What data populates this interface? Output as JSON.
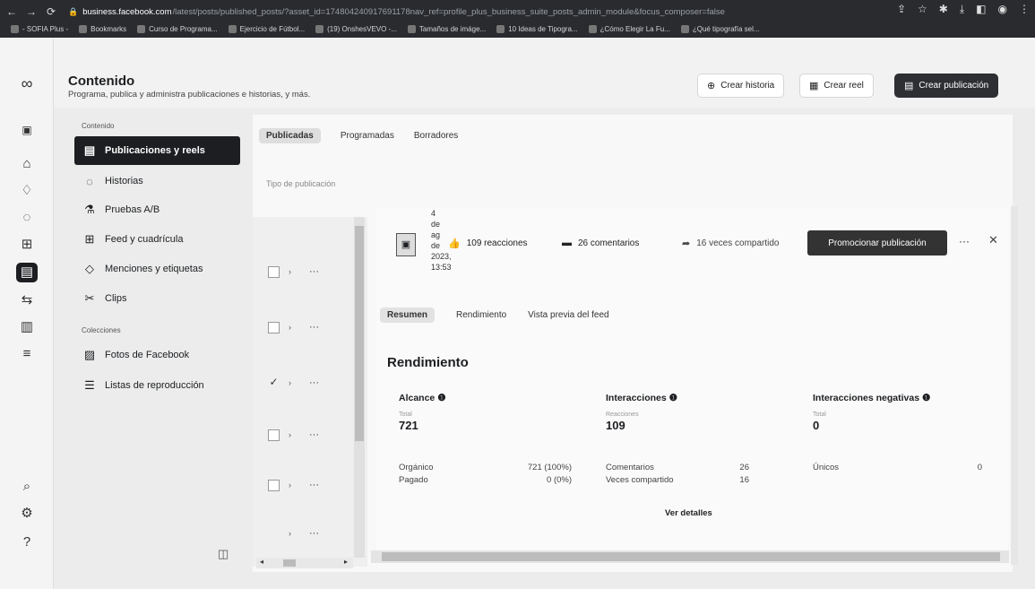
{
  "browser": {
    "url_host": "business.facebook.com",
    "url_path": "/latest/posts/published_posts/?asset_id=174804240917691178nav_ref=profile_plus_business_suite_posts_admin_module&focus_composer=false",
    "bookmarks": [
      {
        "label": "- SOFIA Plus -",
        "icon": "sena-icon"
      },
      {
        "label": "Bookmarks",
        "icon": "star-icon"
      },
      {
        "label": "Curso de Programa...",
        "icon": "globe-icon"
      },
      {
        "label": "Ejercicio de Fútbol...",
        "icon": "page-icon"
      },
      {
        "label": "(19) OnshesVEVO -...",
        "icon": "youtube-icon"
      },
      {
        "label": "Tamaños de imáge...",
        "icon": "page-icon"
      },
      {
        "label": "10 Ideas de Tipogra...",
        "icon": "page-icon"
      },
      {
        "label": "¿Cómo Elegir La Fu...",
        "icon": "page-icon"
      },
      {
        "label": "¿Qué tipografía sel...",
        "icon": "page-icon"
      }
    ]
  },
  "header": {
    "title": "Contenido",
    "subtitle": "Programa, publica y administra publicaciones e historias, y más.",
    "btn_story": "Crear historia",
    "btn_reel": "Crear reel",
    "btn_post": "Crear publicación"
  },
  "sidebar": {
    "section_content": "Contenido",
    "section_collections": "Colecciones",
    "items": [
      {
        "label": "Publicaciones y reels",
        "icon": "posts-icon"
      },
      {
        "label": "Historias",
        "icon": "stories-icon"
      },
      {
        "label": "Pruebas A/B",
        "icon": "flask-icon"
      },
      {
        "label": "Feed y cuadrícula",
        "icon": "grid-icon"
      },
      {
        "label": "Menciones y etiquetas",
        "icon": "tag-icon"
      },
      {
        "label": "Clips",
        "icon": "clip-icon"
      }
    ],
    "collections": [
      {
        "label": "Fotos de Facebook",
        "icon": "photo-icon"
      },
      {
        "label": "Listas de reproducción",
        "icon": "playlist-icon"
      }
    ]
  },
  "main": {
    "tabs": [
      "Publicadas",
      "Programadas",
      "Borradores"
    ],
    "filter_placeholder": "Tipo de publicación"
  },
  "detail": {
    "date_lines": [
      "4",
      "de",
      "ag",
      "de",
      "2023,",
      "13:53"
    ],
    "reactions": "109 reacciones",
    "comments": "26 comentarios",
    "shares": "16 veces compartido",
    "promote": "Promocionar publicación",
    "tabs": [
      "Resumen",
      "Rendimiento",
      "Vista previa del feed"
    ],
    "section_title": "Rendimiento",
    "reach": {
      "title": "Alcance",
      "sub": "Total",
      "value": "721",
      "rows": [
        {
          "label": "Orgánico",
          "value": "721 (100%)"
        },
        {
          "label": "Pagado",
          "value": "0 (0%)"
        }
      ]
    },
    "interactions": {
      "title": "Interacciones",
      "sub": "Reacciones",
      "value": "109",
      "rows": [
        {
          "label": "Comentarios",
          "value": "26"
        },
        {
          "label": "Veces compartido",
          "value": "16"
        }
      ]
    },
    "negative": {
      "title": "Interacciones negativas",
      "sub": "Total",
      "value": "0",
      "rows": [
        {
          "label": "Únicos",
          "value": "0"
        }
      ]
    },
    "details_link": "Ver detalles"
  }
}
